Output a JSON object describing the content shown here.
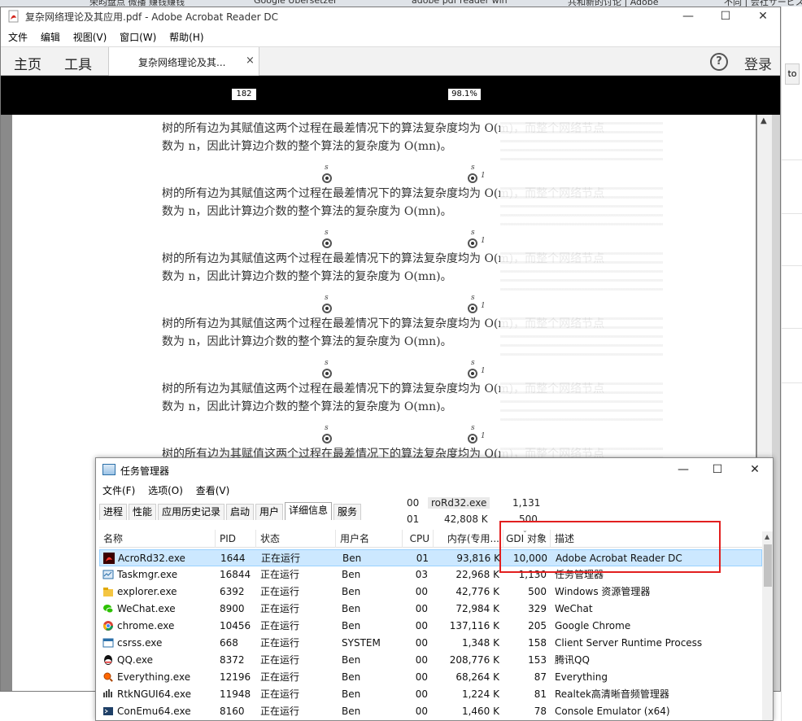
{
  "bg_tabs": [
    "荣昀盘点 微播 赚钱赚钱",
    "Google Übersetzer",
    "adobe pdf reader win",
    "共和新的讨论 | Adobe",
    "不同 | 会社サービスフォ"
  ],
  "bg_right_button": "to",
  "acrobat": {
    "title": "复杂网络理论及其应用.pdf - Adobe Acrobat Reader DC",
    "menu": [
      "文件",
      "编辑",
      "视图(V)",
      "窗口(W)",
      "帮助(H)"
    ],
    "nav_home": "主页",
    "nav_tools": "工具",
    "doc_tab": "复杂网络理论及其...",
    "doc_tab_close": "×",
    "help": "?",
    "login": "登录",
    "page_number": "182",
    "zoom": "98.1%",
    "first_para": [
      "树的所有边为其赋值这两个过程在最差情况下的算法复杂度均为 O(m)，而整个网络节点",
      "数为 n，因此计算边介数的整个算法的复杂度为 O(mn)。"
    ],
    "para_line": "树的所有边为其赋值这两个过程在最差情况下的算法复杂度均为 O(m)，而整个网络节点",
    "para_line2": "数为 n，因此计算边介数的整个算法的复杂度为 O(mn)。",
    "node_label_s": "s",
    "node_label_1": "1"
  },
  "taskmgr": {
    "title": "任务管理器",
    "menu": [
      "文件(F)",
      "选项(O)",
      "查看(V)"
    ],
    "tabs": [
      "进程",
      "性能",
      "应用历史记录",
      "启动",
      "用户",
      "详细信息",
      "服务"
    ],
    "frag_row1": [
      "00",
      "roRd32.exe",
      "1,131"
    ],
    "frag_row2": [
      "01",
      "42,808 K",
      "500"
    ],
    "columns": [
      "名称",
      "PID",
      "状态",
      "用户名",
      "CPU",
      "内存(专用...",
      "GDI 对象",
      "描述"
    ],
    "rows": [
      {
        "name": "AcroRd32.exe",
        "pid": "1644",
        "status": "正在运行",
        "user": "Ben",
        "cpu": "01",
        "mem": "93,816 K",
        "gdi": "10,000",
        "desc": "Adobe Acrobat Reader DC",
        "icon": "acrobat-icon"
      },
      {
        "name": "Taskmgr.exe",
        "pid": "16844",
        "status": "正在运行",
        "user": "Ben",
        "cpu": "03",
        "mem": "22,968 K",
        "gdi": "1,130",
        "desc": "任务管理器",
        "icon": "taskmgr-icon"
      },
      {
        "name": "explorer.exe",
        "pid": "6392",
        "status": "正在运行",
        "user": "Ben",
        "cpu": "00",
        "mem": "42,776 K",
        "gdi": "500",
        "desc": "Windows 资源管理器",
        "icon": "folder-icon"
      },
      {
        "name": "WeChat.exe",
        "pid": "8900",
        "status": "正在运行",
        "user": "Ben",
        "cpu": "00",
        "mem": "72,984 K",
        "gdi": "329",
        "desc": "WeChat",
        "icon": "wechat-icon"
      },
      {
        "name": "chrome.exe",
        "pid": "10456",
        "status": "正在运行",
        "user": "Ben",
        "cpu": "00",
        "mem": "137,116 K",
        "gdi": "205",
        "desc": "Google Chrome",
        "icon": "chrome-icon"
      },
      {
        "name": "csrss.exe",
        "pid": "668",
        "status": "正在运行",
        "user": "SYSTEM",
        "cpu": "00",
        "mem": "1,348 K",
        "gdi": "158",
        "desc": "Client Server Runtime Process",
        "icon": "window-icon"
      },
      {
        "name": "QQ.exe",
        "pid": "8372",
        "status": "正在运行",
        "user": "Ben",
        "cpu": "00",
        "mem": "208,776 K",
        "gdi": "153",
        "desc": "腾讯QQ",
        "icon": "qq-icon"
      },
      {
        "name": "Everything.exe",
        "pid": "12196",
        "status": "正在运行",
        "user": "Ben",
        "cpu": "00",
        "mem": "68,264 K",
        "gdi": "87",
        "desc": "Everything",
        "icon": "search-icon"
      },
      {
        "name": "RtkNGUI64.exe",
        "pid": "11948",
        "status": "正在运行",
        "user": "Ben",
        "cpu": "00",
        "mem": "1,224 K",
        "gdi": "81",
        "desc": "Realtek高清晰音频管理器",
        "icon": "audio-icon"
      },
      {
        "name": "ConEmu64.exe",
        "pid": "8160",
        "status": "正在运行",
        "user": "Ben",
        "cpu": "00",
        "mem": "1,460 K",
        "gdi": "78",
        "desc": "Console Emulator (x64)",
        "icon": "console-icon"
      }
    ]
  },
  "colors": {
    "highlight": "#e21f1f",
    "selection": "#cce8ff",
    "acrobat_red": "#d4251c"
  }
}
